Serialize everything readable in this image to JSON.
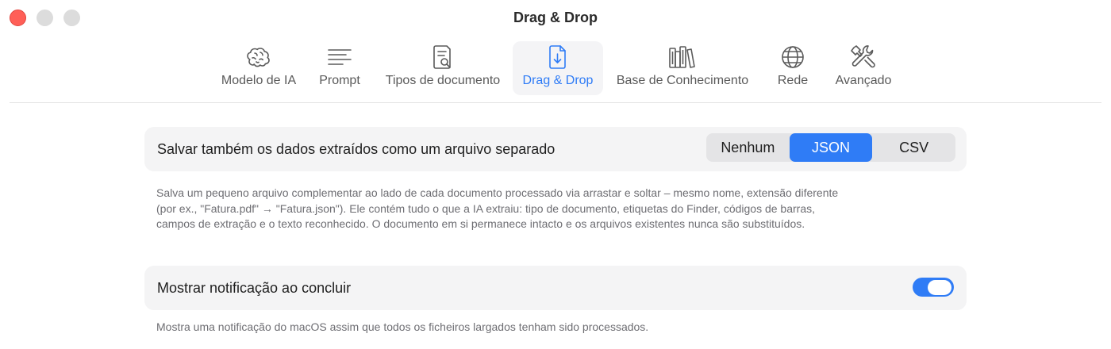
{
  "window": {
    "title": "Drag & Drop"
  },
  "toolbar": {
    "tabs": [
      {
        "label": "Modelo de IA",
        "icon": "brain-icon"
      },
      {
        "label": "Prompt",
        "icon": "text-lines-icon"
      },
      {
        "label": "Tipos de documento",
        "icon": "document-search-icon"
      },
      {
        "label": "Drag & Drop",
        "icon": "document-download-icon",
        "active": true
      },
      {
        "label": "Base de Conhecimento",
        "icon": "books-icon"
      },
      {
        "label": "Rede",
        "icon": "globe-icon"
      },
      {
        "label": "Avançado",
        "icon": "tools-icon"
      }
    ]
  },
  "export_setting": {
    "label": "Salvar também os dados extraídos como um arquivo separado",
    "options": [
      "Nenhum",
      "JSON",
      "CSV"
    ],
    "selected": "JSON",
    "description_line1": "Salva um pequeno arquivo complementar ao lado de cada documento processado via arrastar e soltar – mesmo nome, extensão diferente",
    "description_line2": "(por ex., \"Fatura.pdf\" → \"Fatura.json\"). Ele contém tudo o que a IA extraiu: tipo de documento, etiquetas do Finder, códigos de barras,",
    "description_line3": "campos de extração e o texto reconhecido. O documento em si permanece intacto e os arquivos existentes nunca são substituídos."
  },
  "notification_setting": {
    "label": "Mostrar notificação ao concluir",
    "enabled": true,
    "description": "Mostra uma notificação do macOS assim que todos os ficheiros largados tenham sido processados."
  },
  "colors": {
    "accent": "#2f7cf6",
    "close": "#ff5f57"
  }
}
